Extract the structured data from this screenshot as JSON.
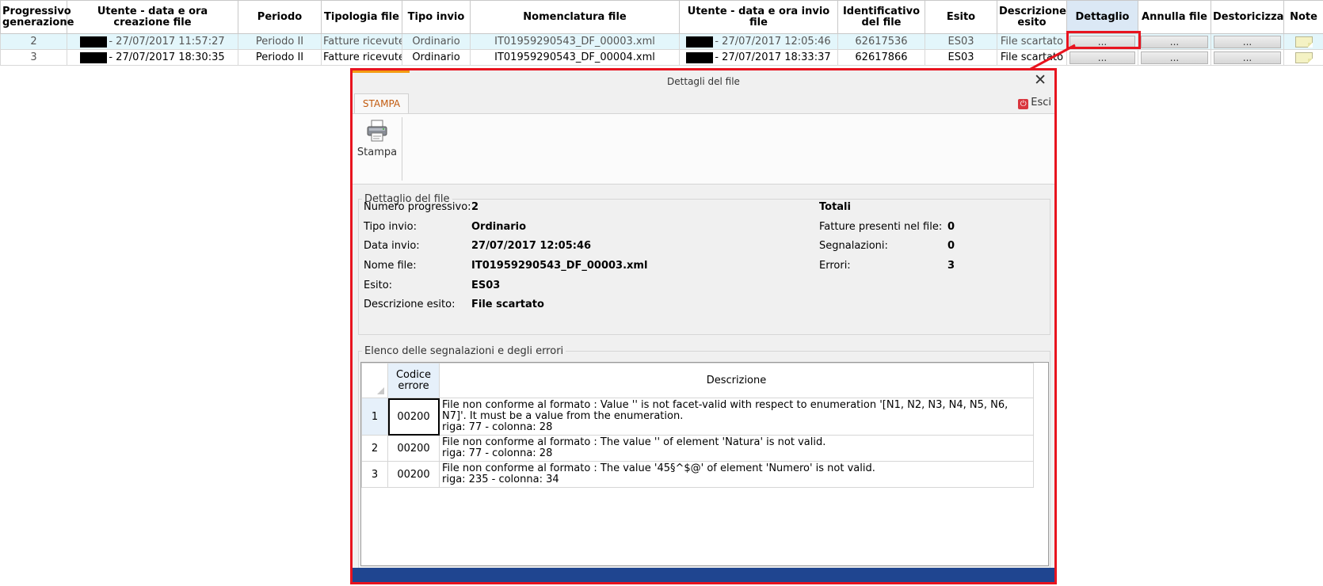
{
  "grid": {
    "headers": [
      "Progressivo generazione",
      "Utente - data e ora creazione file",
      "Periodo",
      "Tipologia file",
      "Tipo invio",
      "Nomenclatura file",
      "Utente - data e ora invio file",
      "Identificativo del file",
      "Esito",
      "Descrizione esito",
      "Dettaglio",
      "Annulla file",
      "Destoricizza",
      "Note"
    ],
    "rows": [
      {
        "progressivo": "2",
        "creazione": "- 27/07/2017 11:57:27",
        "periodo": "Periodo II",
        "tipologia": "Fatture ricevute",
        "tipo_invio": "Ordinario",
        "nomenclatura": "IT01959290543_DF_00003.xml",
        "invio": "- 27/07/2017 12:05:46",
        "identificativo": "62617536",
        "esito": "ES03",
        "descrizione": "File scartato",
        "btn_dettaglio": "...",
        "btn_annulla": "...",
        "btn_destoricizza": "..."
      },
      {
        "progressivo": "3",
        "creazione": "- 27/07/2017 18:30:35",
        "periodo": "Periodo II",
        "tipologia": "Fatture ricevute",
        "tipo_invio": "Ordinario",
        "nomenclatura": "IT01959290543_DF_00004.xml",
        "invio": "- 27/07/2017 18:33:37",
        "identificativo": "62617866",
        "esito": "ES03",
        "descrizione": "File scartato",
        "btn_dettaglio": "...",
        "btn_annulla": "...",
        "btn_destoricizza": "..."
      }
    ]
  },
  "dialog": {
    "title": "Dettagli del file",
    "close_glyph": "✕",
    "tab_label": "STAMPA",
    "exit_label": "Esci",
    "print_label": "Stampa",
    "detail_section": {
      "legend": "Dettaglio del file",
      "fields": [
        {
          "label": "Numero progressivo:",
          "value": "2"
        },
        {
          "label": "Tipo invio:",
          "value": "Ordinario"
        },
        {
          "label": "Data invio:",
          "value": "27/07/2017 12:05:46"
        },
        {
          "label": "Nome file:",
          "value": "IT01959290543_DF_00003.xml"
        },
        {
          "label": "Esito:",
          "value": "ES03"
        },
        {
          "label": "Descrizione esito:",
          "value": "File scartato"
        }
      ],
      "totals_title": "Totali",
      "totals": [
        {
          "label": "Fatture presenti nel file:",
          "value": "0"
        },
        {
          "label": "Segnalazioni:",
          "value": "0"
        },
        {
          "label": "Errori:",
          "value": "3"
        }
      ]
    },
    "errors_section": {
      "legend": "Elenco delle segnalazioni e degli errori",
      "col_code": "Codice errore",
      "col_desc": "Descrizione",
      "rows": [
        {
          "n": "1",
          "code": "00200",
          "desc": "File non conforme al formato : Value '' is not facet-valid with respect to enumeration '[N1, N2, N3, N4, N5, N6, N7]'. It must be a value from the enumeration.",
          "pos": "riga: 77 - colonna: 28"
        },
        {
          "n": "2",
          "code": "00200",
          "desc": "File non conforme al formato : The value '' of element 'Natura' is not valid.",
          "pos": "riga: 77 - colonna: 28"
        },
        {
          "n": "3",
          "code": "00200",
          "desc": "File non conforme al formato : The value '45§^$@' of element 'Numero' is not valid.",
          "pos": "riga: 235 - colonna: 34"
        }
      ]
    }
  },
  "colors": {
    "highlight_red": "#e8141f",
    "accent_orange": "#f39c12",
    "footer_blue": "#1f4590",
    "selected_row": "#e3f6fb"
  }
}
